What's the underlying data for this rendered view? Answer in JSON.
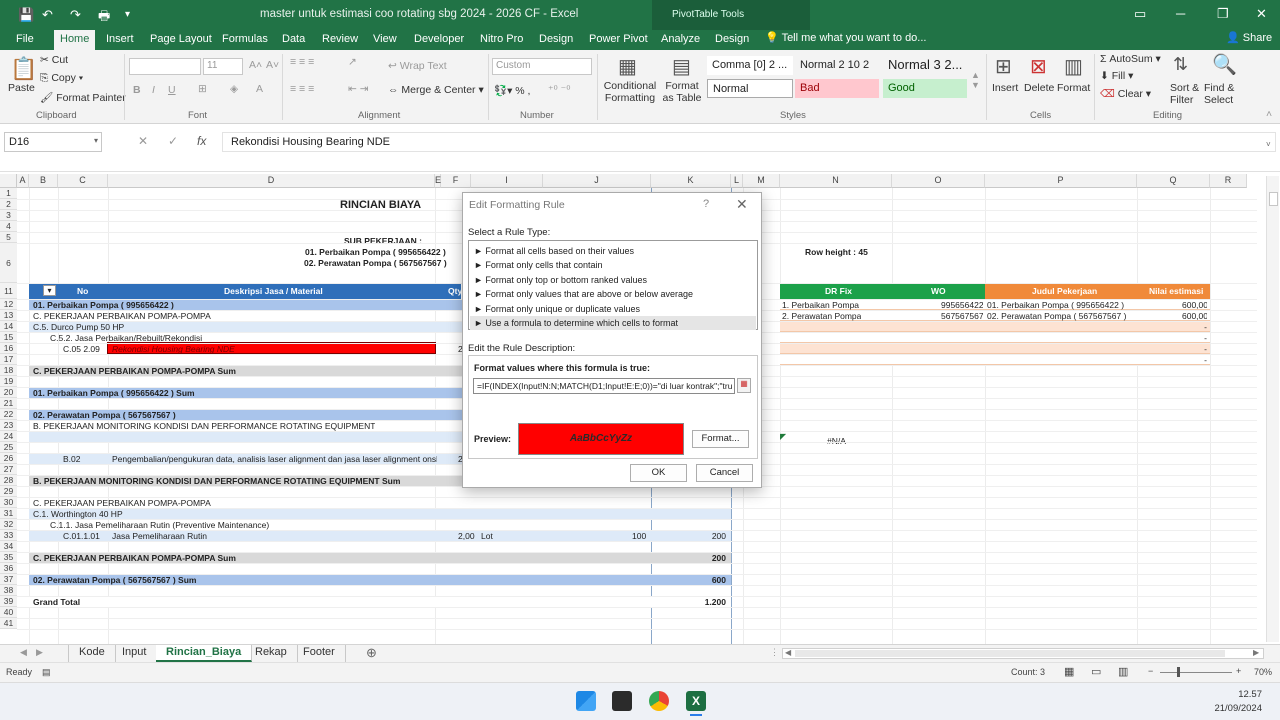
{
  "window": {
    "title": "master untuk estimasi coo rotating sbg 2024 - 2026 CF  -  Excel",
    "contextual_tab": "PivotTable Tools",
    "undo_icon": "undo-icon",
    "redo_icon": "redo-icon"
  },
  "ribbon_tabs": [
    "File",
    "Home",
    "Insert",
    "Page Layout",
    "Formulas",
    "Data",
    "Review",
    "View",
    "Developer",
    "Nitro Pro",
    "Design",
    "Power Pivot",
    "Analyze",
    "Design"
  ],
  "active_tab": "Home",
  "tell_me": "Tell me what you want to do...",
  "share": "Share",
  "ribbon": {
    "clipboard": {
      "paste": "Paste",
      "cut": "Cut",
      "copy": "Copy",
      "format_painter": "Format Painter",
      "label": "Clipboard"
    },
    "font": {
      "size": "11",
      "bold": "B",
      "italic": "I",
      "underline": "U",
      "label": "Font"
    },
    "alignment": {
      "wrap_text": "Wrap Text",
      "merge_center": "Merge & Center",
      "label": "Alignment"
    },
    "number": {
      "format": "Custom",
      "label": "Number"
    },
    "styles": {
      "conditional": "Conditional Formatting",
      "format_as_table": "Format as Table",
      "cells": [
        {
          "text": "Comma [0] 2 ...",
          "bg": "#ffffff",
          "fg": "#222222"
        },
        {
          "text": "Normal 2 10 2",
          "bg": "#f3f3f3",
          "fg": "#222222"
        },
        {
          "text": "Normal 3 2...",
          "bg": "#f3f3f3",
          "fg": "#222222"
        },
        {
          "text": "Normal",
          "bg": "#ffffff",
          "fg": "#222222"
        },
        {
          "text": "Bad",
          "bg": "#ffc7ce",
          "fg": "#9c0006"
        },
        {
          "text": "Good",
          "bg": "#c6efce",
          "fg": "#006100"
        }
      ],
      "label": "Styles"
    },
    "cells": {
      "insert": "Insert",
      "delete": "Delete",
      "format": "Format",
      "label": "Cells"
    },
    "editing": {
      "autosum": "AutoSum",
      "fill": "Fill",
      "clear": "Clear",
      "sort_filter": "Sort & Filter",
      "find_select": "Find & Select",
      "label": "Editing"
    }
  },
  "formula_bar": {
    "name_box": "D16",
    "fx": "fx",
    "formula": "Rekondisi Housing Bearing NDE"
  },
  "columns": [
    "A",
    "B",
    "C",
    "D",
    "E",
    "F",
    "I",
    "J",
    "K",
    "L",
    "M",
    "N",
    "O",
    "P",
    "Q",
    "R"
  ],
  "rows": [
    "1",
    "2",
    "3",
    "4",
    "5",
    "6",
    "11",
    "12",
    "13",
    "14",
    "15",
    "16",
    "17",
    "18",
    "19",
    "20",
    "21",
    "22",
    "23",
    "24",
    "25",
    "26",
    "27",
    "28",
    "29",
    "30",
    "31",
    "32",
    "33",
    "34",
    "35",
    "36",
    "37",
    "38",
    "39",
    "40",
    "41"
  ],
  "sheet": {
    "title": "RINCIAN BIAYA",
    "sub_pekerjaan": "SUB PEKERJAAN :",
    "sub1": "01. Perbaikan Pompa ( 995656422 )",
    "sub2": "02. Perawatan Pompa ( 567567567 )",
    "row_height_note": "Row height : 45",
    "header_no": "No",
    "header_desc": "Deskripsi Jasa / Material",
    "header_qty": "Qty",
    "na": "#N/A",
    "lines": [
      {
        "c": "01. Perbaikan Pompa ( 995656422 )",
        "style": "section"
      },
      {
        "c": "C. PEKERJAAN PERBAIKAN POMPA-POMPA",
        "style": "plain"
      },
      {
        "c": "C.5. Durco Pump 50 HP",
        "style": "light"
      },
      {
        "c": "C.5.2. Jasa Perbaikan/Rebuilt/Rekondisi",
        "style": "plain"
      },
      {
        "c": "C.05 2.09",
        "d": "Rekondisi Housing Bearing NDE",
        "f": "2",
        "style": "red"
      },
      {
        "c": "",
        "style": "plain"
      },
      {
        "c": "C. PEKERJAAN PERBAIKAN POMPA-POMPA Sum",
        "style": "sum"
      },
      {
        "c": "",
        "style": "plain"
      },
      {
        "c": "01. Perbaikan Pompa ( 995656422 )  Sum",
        "style": "section"
      },
      {
        "c": "",
        "style": "plain"
      },
      {
        "c": "02. Perawatan Pompa ( 567567567 )",
        "style": "section"
      },
      {
        "c": "B. PEKERJAAN MONITORING KONDISI DAN PERFORMANCE ROTATING EQUIPMENT",
        "style": "plain"
      },
      {
        "c": "",
        "style": "light"
      },
      {
        "c": "",
        "style": "plain"
      },
      {
        "c": "B.02",
        "d": "Pengembalian/pengukuran data, analisis laser alignment dan jasa laser alignment onsh",
        "f": "2",
        "style": "light"
      },
      {
        "c": "",
        "style": "plain"
      },
      {
        "c": "B. PEKERJAAN MONITORING KONDISI DAN PERFORMANCE ROTATING EQUIPMENT Sum",
        "style": "sum"
      },
      {
        "c": "",
        "style": "plain"
      },
      {
        "c": "C. PEKERJAAN PERBAIKAN POMPA-POMPA",
        "style": "plain"
      },
      {
        "c": "C.1. Worthington 40 HP",
        "style": "light"
      },
      {
        "c": "C.1.1. Jasa Pemeliharaan Rutin (Preventive Maintenance)",
        "style": "plain"
      },
      {
        "c": "C.01.1.01",
        "d": "Jasa Pemeliharaan Rutin",
        "f": "2,00",
        "i": "Lot",
        "j": "100",
        "k": "200",
        "style": "light"
      },
      {
        "c": "",
        "style": "plain"
      },
      {
        "c": "C. PEKERJAAN PERBAIKAN POMPA-POMPA Sum",
        "k": "200",
        "style": "sum"
      },
      {
        "c": "",
        "style": "plain"
      },
      {
        "c": "02. Perawatan Pompa ( 567567567 )  Sum",
        "k": "600",
        "style": "section"
      },
      {
        "c": "",
        "style": "plain"
      },
      {
        "c": "Grand Total",
        "k": "1.200",
        "style": "total"
      }
    ],
    "right_table": {
      "headers": [
        "DR Fix",
        "WO",
        "Judul Pekerjaan",
        "Nilai estimasi"
      ],
      "rows": [
        [
          "1. Perbaikan Pompa",
          "995656422",
          "01. Perbaikan Pompa ( 995656422 )",
          "600,00"
        ],
        [
          "2. Perawatan Pompa",
          "567567567",
          "02. Perawatan Pompa ( 567567567 )",
          "600,00"
        ],
        [
          "",
          "",
          "",
          "-"
        ],
        [
          "",
          "",
          "",
          "-"
        ],
        [
          "",
          "",
          "",
          "-"
        ],
        [
          "",
          "",
          "",
          "-"
        ]
      ]
    }
  },
  "dialog": {
    "title": "Edit Formatting Rule",
    "help": "?",
    "close": "✕",
    "select_label": "Select a Rule Type:",
    "rules": [
      "► Format all cells based on their values",
      "► Format only cells that contain",
      "► Format only top or bottom ranked values",
      "► Format only values that are above or below average",
      "► Format only unique or duplicate values",
      "► Use a formula to determine which cells to format"
    ],
    "selected_rule": 5,
    "edit_label": "Edit the Rule Description:",
    "formula_label": "Format values where this formula is true:",
    "formula": "=IF(INDEX(Input!N:N;MATCH(D1;Input!E:E;0))=\"di luar kontrak\";\"tru",
    "preview_label": "Preview:",
    "preview_text": "AaBbCcYyZz",
    "format_btn": "Format...",
    "ok": "OK",
    "cancel": "Cancel"
  },
  "sheet_tabs": [
    "Kode",
    "Input",
    "Rincian_Biaya",
    "Rekap",
    "Footer"
  ],
  "active_sheet": "Rincian_Biaya",
  "status": {
    "ready": "Ready",
    "count": "Count: 3",
    "zoom": "70%"
  },
  "taskbar": {
    "time": "12.57",
    "date": "21/09/2024"
  },
  "colors": {
    "excel_green": "#217346",
    "section_blue": "#a9c4eb",
    "header_blue": "#2f6fba",
    "red_highlight": "#ff0000",
    "green_header": "#1ca14a",
    "orange_header": "#f08a3a"
  }
}
